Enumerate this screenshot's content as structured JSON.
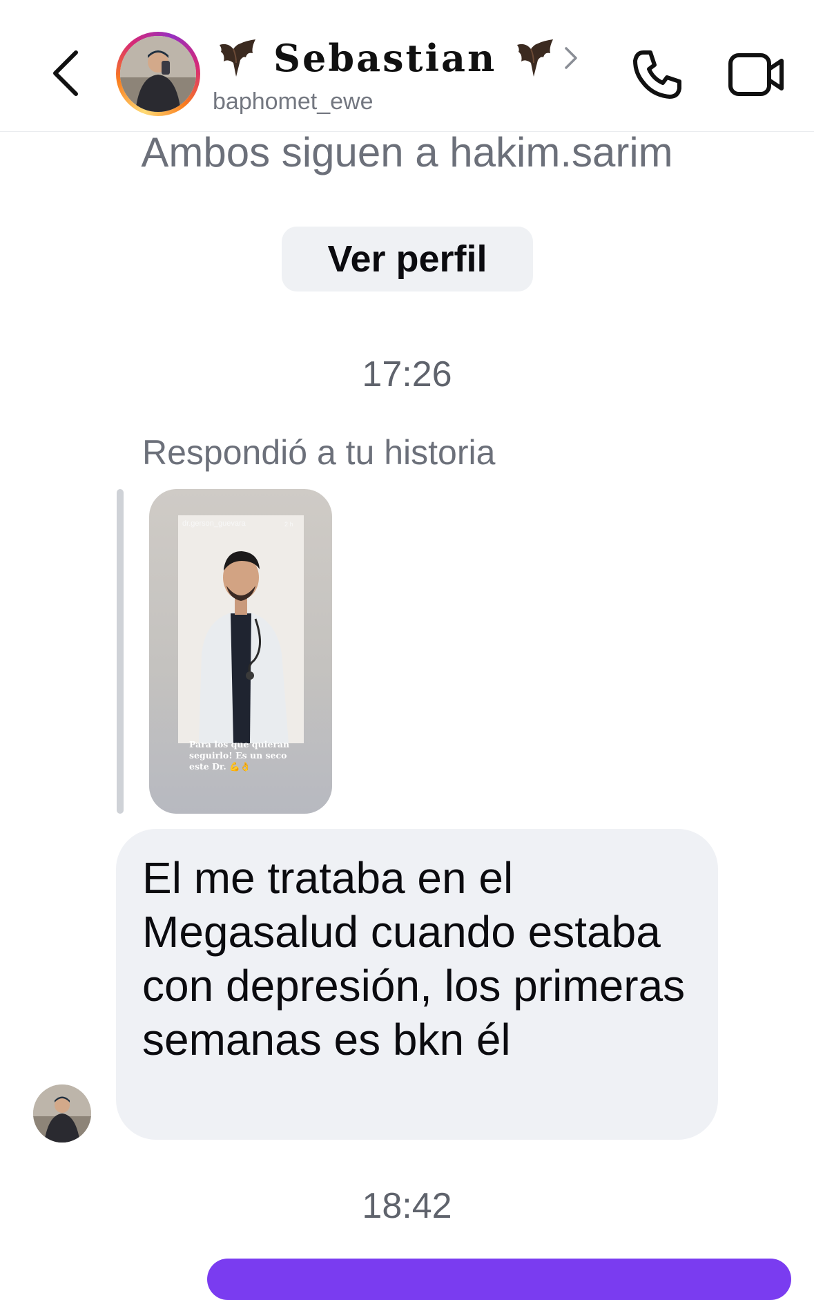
{
  "header": {
    "display_name": "Sebastian",
    "username": "baphomet_ewe"
  },
  "chat": {
    "mutual_followers": "Ambos siguen a hakim.sarim",
    "view_profile_label": "Ver perfil",
    "timestamp_1": "17:26",
    "reply_context": "Respondió a tu historia",
    "story": {
      "username": "dr.gerson_guevara",
      "time": "2 h",
      "caption": "Para los que quieran seguirlo! Es un seco este Dr. 💪👌"
    },
    "message": "El me trataba en el Megasalud cuando estaba con depresión, los primeras semanas es bkn él",
    "timestamp_2": "18:42"
  },
  "colors": {
    "outgoing_bubble": "#7a3cf0",
    "incoming_bubble": "#eff1f5",
    "secondary_text": "#6c707a"
  }
}
